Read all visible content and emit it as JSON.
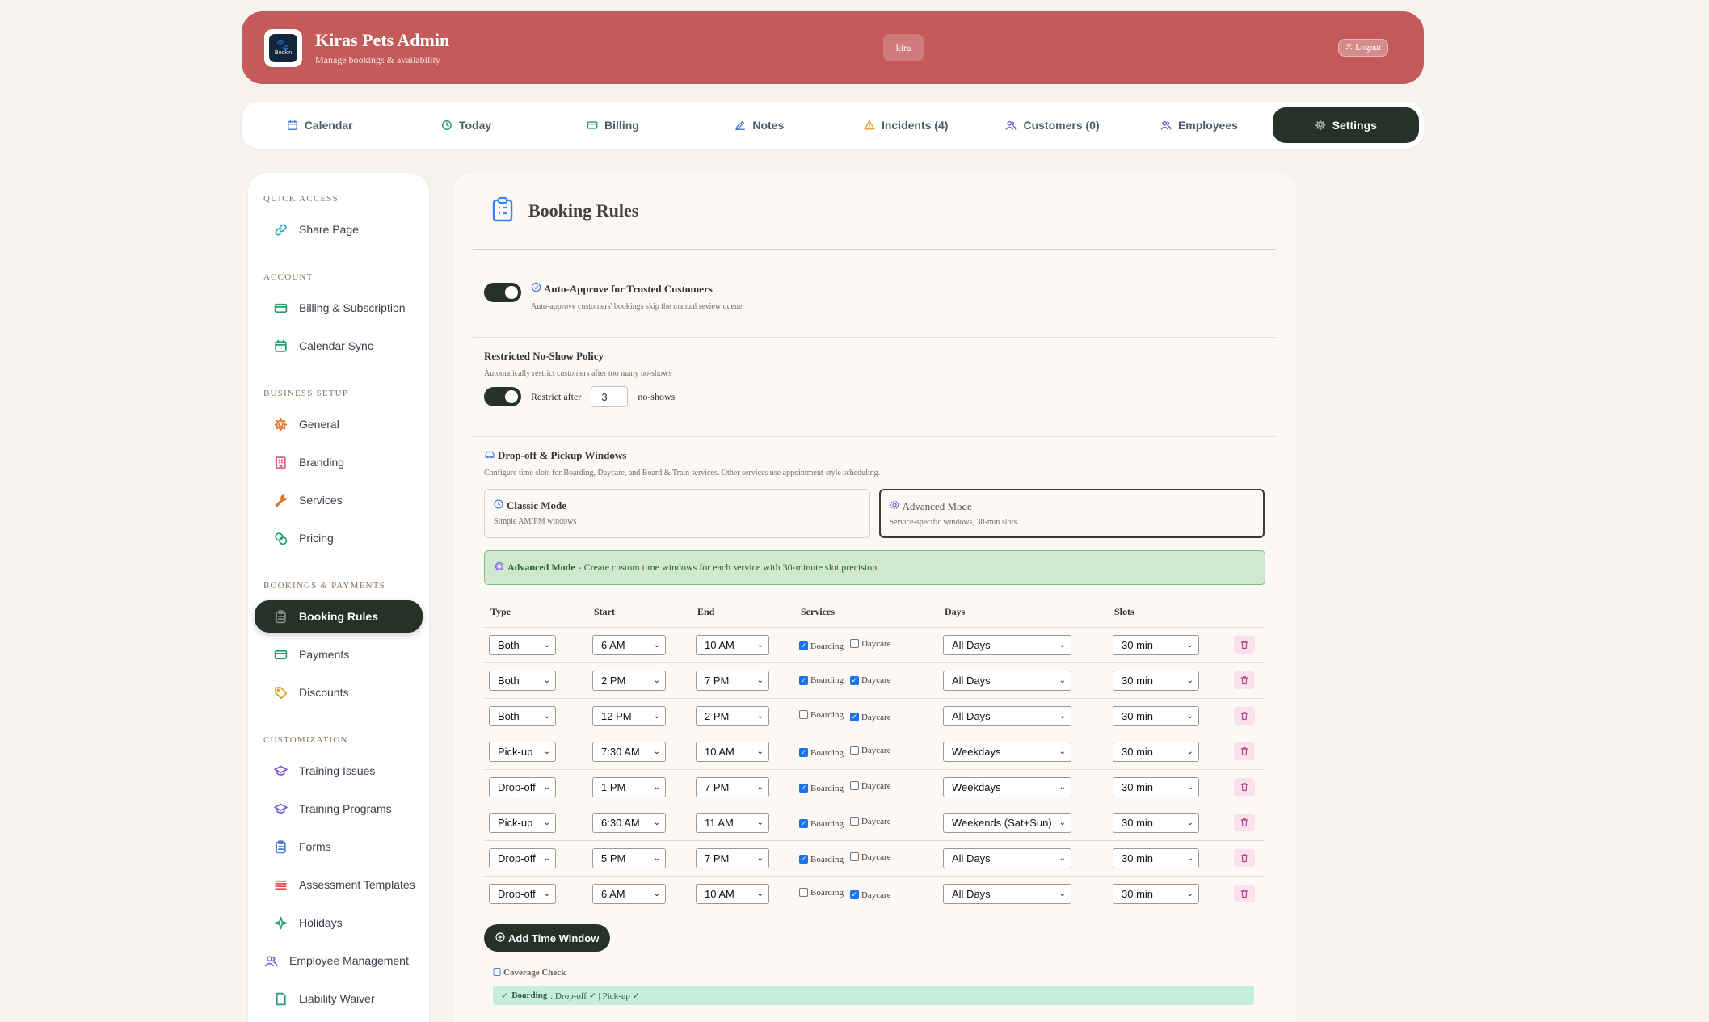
{
  "header": {
    "title": "Kiras Pets Admin",
    "subtitle": "Manage bookings & availability",
    "logo_text": "Book'n",
    "user": "kira",
    "logout_label": "Logout",
    "color": "#c45a5a"
  },
  "nav": {
    "tabs": [
      {
        "label": "Calendar",
        "icon": "calendar-icon",
        "color": "#4a7fd6"
      },
      {
        "label": "Today",
        "icon": "clock-icon",
        "color": "#22a06b"
      },
      {
        "label": "Billing",
        "icon": "credit-card-icon",
        "color": "#22a06b"
      },
      {
        "label": "Notes",
        "icon": "edit-icon",
        "color": "#4a7fd6"
      },
      {
        "label": "Incidents (4)",
        "icon": "warning-icon",
        "color": "#e0a020"
      },
      {
        "label": "Customers (0)",
        "icon": "users-icon",
        "color": "#7a5cd6"
      },
      {
        "label": "Employees",
        "icon": "users-icon",
        "color": "#7a5cd6"
      },
      {
        "label": "Settings",
        "icon": "gear-icon",
        "color": "#ffffff"
      }
    ],
    "active": "Settings"
  },
  "sidebar": {
    "sections": [
      {
        "title": "Quick Access",
        "items": [
          {
            "label": "Share Page",
            "icon": "link-icon"
          }
        ]
      },
      {
        "title": "Account",
        "items": [
          {
            "label": "Billing & Subscription",
            "icon": "credit-card-icon"
          },
          {
            "label": "Calendar Sync",
            "icon": "calendar-icon"
          }
        ]
      },
      {
        "title": "Business Setup",
        "items": [
          {
            "label": "General",
            "icon": "gear-icon"
          },
          {
            "label": "Branding",
            "icon": "building-icon"
          },
          {
            "label": "Services",
            "icon": "wrench-icon"
          },
          {
            "label": "Pricing",
            "icon": "coins-icon"
          }
        ]
      },
      {
        "title": "Bookings & Payments",
        "items": [
          {
            "label": "Booking Rules",
            "icon": "clipboard-icon"
          },
          {
            "label": "Payments",
            "icon": "credit-card-icon"
          },
          {
            "label": "Discounts",
            "icon": "tag-icon"
          }
        ]
      },
      {
        "title": "Customization",
        "items": [
          {
            "label": "Training Issues",
            "icon": "graduation-cap-icon"
          },
          {
            "label": "Training Programs",
            "icon": "graduation-cap-icon"
          },
          {
            "label": "Forms",
            "icon": "clipboard-icon"
          },
          {
            "label": "Assessment Templates",
            "icon": "list-icon"
          },
          {
            "label": "Holidays",
            "icon": "sparkle-icon"
          },
          {
            "label": "Employee Management",
            "icon": "users-icon"
          },
          {
            "label": "Liability Waiver",
            "icon": "document-icon"
          }
        ]
      }
    ],
    "active": "Booking Rules"
  },
  "main": {
    "title": "Booking Rules",
    "auto_approve": {
      "label": "Auto-Approve for Trusted Customers",
      "desc": "Auto-approve customers' bookings skip the manual review queue",
      "enabled": true
    },
    "no_show": {
      "title": "Restricted No-Show Policy",
      "desc": "Automatically restrict customers after too many no-shows",
      "enabled": true,
      "prefix": "Restrict after",
      "count": "3",
      "suffix": "no-shows"
    },
    "windows": {
      "title": "Drop-off & Pickup Windows",
      "desc": "Configure time slots for Boarding, Daycare, and Board & Train services. Other services use appointment-style scheduling.",
      "modes": [
        {
          "title": "Classic Mode",
          "sub": "Simple AM/PM windows",
          "selected": false
        },
        {
          "title": "Advanced Mode",
          "sub": "Service-specific windows, 30-min slots",
          "selected": true
        }
      ],
      "banner_strong": "Advanced Mode",
      "banner_text": " - Create custom time windows for each service with 30-minute slot precision.",
      "columns": [
        "Type",
        "Start",
        "End",
        "Services",
        "Days",
        "Slots"
      ],
      "service_labels": [
        "Boarding",
        "Daycare"
      ],
      "rows": [
        {
          "type": "Both",
          "start": "6 AM",
          "end": "10 AM",
          "boarding": true,
          "daycare": false,
          "days": "All Days",
          "slots": "30 min"
        },
        {
          "type": "Both",
          "start": "2 PM",
          "end": "7 PM",
          "boarding": true,
          "daycare": true,
          "days": "All Days",
          "slots": "30 min"
        },
        {
          "type": "Both",
          "start": "12 PM",
          "end": "2 PM",
          "boarding": false,
          "daycare": true,
          "days": "All Days",
          "slots": "30 min"
        },
        {
          "type": "Pick-up",
          "start": "7:30 AM",
          "end": "10 AM",
          "boarding": true,
          "daycare": false,
          "days": "Weekdays",
          "slots": "30 min"
        },
        {
          "type": "Drop-off",
          "start": "1 PM",
          "end": "7 PM",
          "boarding": true,
          "daycare": false,
          "days": "Weekdays",
          "slots": "30 min"
        },
        {
          "type": "Pick-up",
          "start": "6:30 AM",
          "end": "11 AM",
          "boarding": true,
          "daycare": false,
          "days": "Weekends (Sat+Sun)",
          "slots": "30 min"
        },
        {
          "type": "Drop-off",
          "start": "5 PM",
          "end": "7 PM",
          "boarding": true,
          "daycare": false,
          "days": "All Days",
          "slots": "30 min"
        },
        {
          "type": "Drop-off",
          "start": "6 AM",
          "end": "10 AM",
          "boarding": false,
          "daycare": true,
          "days": "All Days",
          "slots": "30 min"
        }
      ],
      "add_label": "Add Time Window",
      "coverage_title": "Coverage Check",
      "coverage_service": "Boarding",
      "coverage_text": ": Drop-off ✓ | Pick-up ✓"
    }
  }
}
